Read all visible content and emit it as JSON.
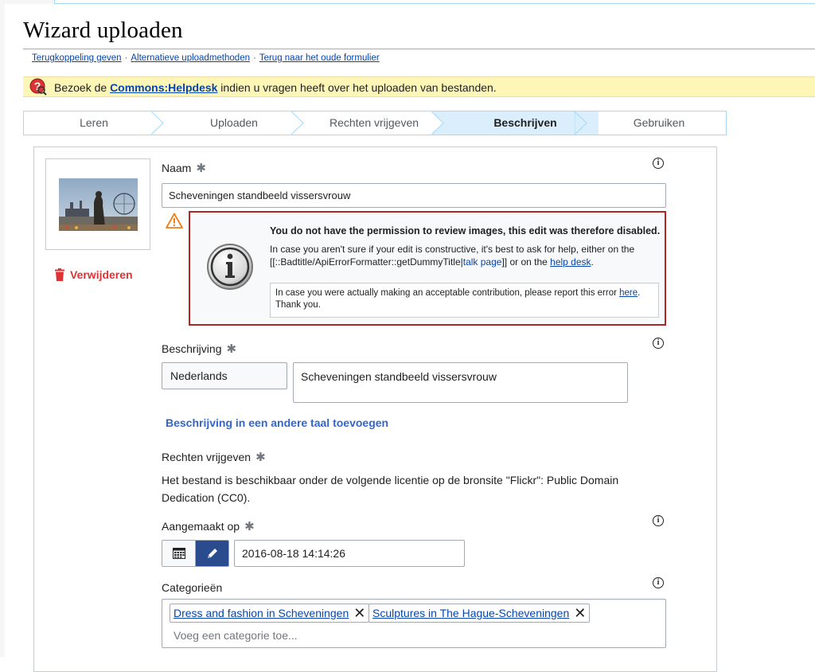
{
  "page": {
    "title": "Wizard uploaden",
    "links": [
      "Terugkoppeling geven",
      "Alternatieve uploadmethoden",
      "Terug naar het oude formulier"
    ],
    "separator": "·"
  },
  "notice": {
    "prefix": "Bezoek de ",
    "link": "Commons:Helpdesk",
    "suffix": " indien u vragen heeft over het uploaden van bestanden."
  },
  "steps": {
    "items": [
      "Leren",
      "Uploaden",
      "Rechten vrijgeven",
      "Beschrijven",
      "Gebruiken"
    ],
    "active": "Beschrijven"
  },
  "file": {
    "remove_label": "Verwijderen"
  },
  "name_field": {
    "label": "Naam",
    "value": "Scheveningen standbeeld vissersvrouw"
  },
  "error": {
    "title": "You do not have the permission to review images, this edit was therefore disabled.",
    "body_1": "In case you aren't sure if your edit is constructive, it's best to ask for help, either on the [[::Badtitle/ApiErrorFormatter::getDummyTitle|",
    "talk_link": "talk page",
    "body_2": "]] or on the ",
    "help_link": "help desk",
    "body_3": ".",
    "inner_1": "In case you were actually making an acceptable contribution, please report this error ",
    "inner_link": "here",
    "inner_2": ". Thank you."
  },
  "description": {
    "label": "Beschrijving",
    "language": "Nederlands",
    "value": "Scheveningen standbeeld vissersvrouw",
    "add_language": "Beschrijving in een andere taal toevoegen"
  },
  "license": {
    "label": "Rechten vrijgeven",
    "text": "Het bestand is beschikbaar onder de volgende licentie op de bronsite \"Flickr\": Public Domain Dedication (CC0)."
  },
  "date": {
    "label": "Aangemaakt op",
    "value": "2016-08-18 14:14:26"
  },
  "categories": {
    "label": "Categorieën",
    "items": [
      "Dress and fashion in Scheveningen",
      "Sculptures in The Hague-Scheveningen"
    ],
    "placeholder": "Voeg een categorie toe..."
  },
  "required_mark": "✱",
  "info_mark": "i",
  "colors": {
    "accent": "#36c",
    "link": "#0645ad",
    "error_border": "#b32424",
    "remove_red": "#d33",
    "notice_bg": "#fef6b7",
    "step_active_bg": "#daeefc",
    "date_toggle": "#2a4b8d"
  }
}
